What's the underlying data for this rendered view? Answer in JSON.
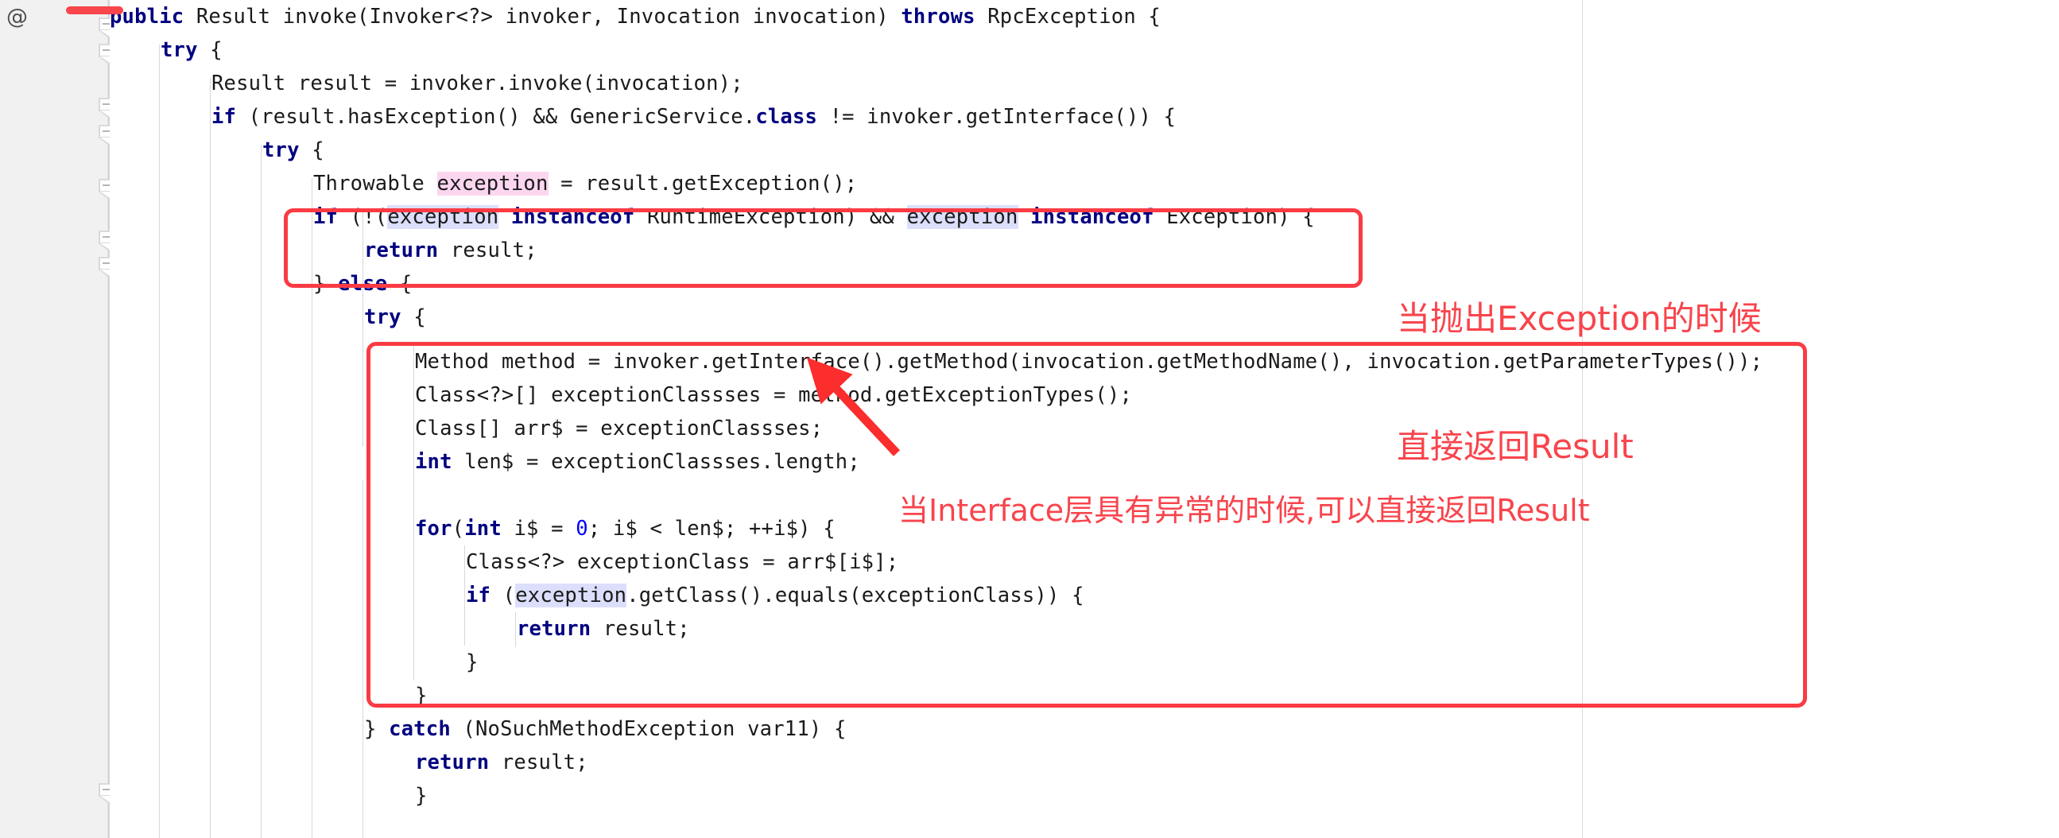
{
  "editor": {
    "gutter": {
      "at_symbol": "@",
      "fold_marker_name": "fold-collapse-marker"
    },
    "language": "java",
    "code_lines": [
      {
        "id": "l1",
        "indent": 0,
        "text": "public Result invoke(Invoker<?> invoker, Invocation invocation) throws RpcException {"
      },
      {
        "id": "l2",
        "indent": 1,
        "text": "try {"
      },
      {
        "id": "l3",
        "indent": 2,
        "text": "Result result = invoker.invoke(invocation);"
      },
      {
        "id": "l4",
        "indent": 2,
        "text": "if (result.hasException() && GenericService.class != invoker.getInterface()) {"
      },
      {
        "id": "l5",
        "indent": 3,
        "text": "try {"
      },
      {
        "id": "l6",
        "indent": 4,
        "text": "Throwable exception = result.getException();"
      },
      {
        "id": "l7",
        "indent": 4,
        "text": "if (!(exception instanceof RuntimeException) && exception instanceof Exception) {"
      },
      {
        "id": "l8",
        "indent": 5,
        "text": "return result;"
      },
      {
        "id": "l9",
        "indent": 4,
        "text": "} else {"
      },
      {
        "id": "l10",
        "indent": 5,
        "text": "try {"
      },
      {
        "id": "l11",
        "indent": 6,
        "text": "Method method = invoker.getInterface().getMethod(invocation.getMethodName(), invocation.getParameterTypes());"
      },
      {
        "id": "l12",
        "indent": 6,
        "text": "Class<?>[] exceptionClassses = method.getExceptionTypes();"
      },
      {
        "id": "l13",
        "indent": 6,
        "text": "Class[] arr$ = exceptionClassses;"
      },
      {
        "id": "l14",
        "indent": 6,
        "text": "int len$ = exceptionClassses.length;"
      },
      {
        "id": "l15",
        "indent": 6,
        "text": ""
      },
      {
        "id": "l16",
        "indent": 6,
        "text": "for(int i$ = 0; i$ < len$; ++i$) {"
      },
      {
        "id": "l17",
        "indent": 7,
        "text": "Class<?> exceptionClass = arr$[i$];"
      },
      {
        "id": "l18",
        "indent": 7,
        "text": "if (exception.getClass().equals(exceptionClass)) {"
      },
      {
        "id": "l19",
        "indent": 8,
        "text": "return result;"
      },
      {
        "id": "l20",
        "indent": 7,
        "text": "}"
      },
      {
        "id": "l21",
        "indent": 6,
        "text": "}"
      },
      {
        "id": "l22",
        "indent": 5,
        "text": "} catch (NoSuchMethodException var11) {"
      },
      {
        "id": "l23",
        "indent": 6,
        "text": "return result;"
      },
      {
        "id": "l24",
        "indent": 5,
        "text": "}"
      }
    ]
  },
  "annotations": {
    "note_1": {
      "line_1": "当抛出Exception的时候",
      "line_2": "直接返回Result",
      "color": "#f8444c"
    },
    "note_2": {
      "line_1": "当Interface层具有异常的时候,可以直接返回Result",
      "color": "#f8444c"
    },
    "box_1_name": "highlight-box-exception-check",
    "box_2_name": "highlight-box-interface-exception-types",
    "arrow_name": "pointer-arrow-getinterface",
    "top_bar_name": "red-marker-bar"
  },
  "colors": {
    "keyword": "#000080",
    "number": "#0000ff",
    "text": "#1a1a1a",
    "annotation_red": "#fa3b44",
    "highlight_declaration": "#fbd6ef",
    "highlight_usage": "#dcdffb",
    "gutter_bg": "#f1f1f1"
  }
}
